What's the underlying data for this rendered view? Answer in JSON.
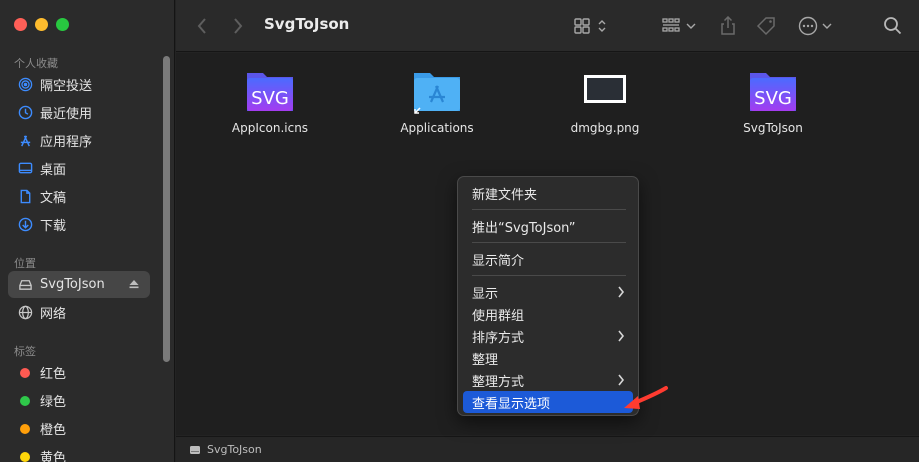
{
  "window": {
    "title": "SvgToJson"
  },
  "sidebar": {
    "favorites_header": "个人收藏",
    "favorites": [
      {
        "label": "隔空投送",
        "icon": "airdrop-icon"
      },
      {
        "label": "最近使用",
        "icon": "clock-icon"
      },
      {
        "label": "应用程序",
        "icon": "applications-icon"
      },
      {
        "label": "桌面",
        "icon": "desktop-icon"
      },
      {
        "label": "文稿",
        "icon": "document-icon"
      },
      {
        "label": "下载",
        "icon": "download-icon"
      }
    ],
    "locations_header": "位置",
    "locations": [
      {
        "label": "SvgToJson",
        "icon": "disk-icon",
        "selected": true
      },
      {
        "label": "网络",
        "icon": "network-icon"
      }
    ],
    "tags_header": "标签",
    "tags": [
      {
        "label": "红色",
        "color": "#ff5a52"
      },
      {
        "label": "绿色",
        "color": "#2fc84a"
      },
      {
        "label": "橙色",
        "color": "#ff9f0a"
      },
      {
        "label": "黄色",
        "color": "#ffd60a"
      }
    ]
  },
  "files": [
    {
      "name": "AppIcon.icns",
      "icon": "svg-badge-icon"
    },
    {
      "name": "Applications",
      "icon": "applications-folder-icon"
    },
    {
      "name": "dmgbg.png",
      "icon": "image-thumbnail-icon"
    },
    {
      "name": "SvgToJson",
      "icon": "svg-badge-icon"
    }
  ],
  "file_icon_text": "SVG",
  "context_menu": {
    "items": [
      {
        "label": "新建文件夹"
      },
      {
        "label": "推出“SvgToJson”"
      },
      {
        "label": "显示简介"
      },
      {
        "label": "显示",
        "submenu": true
      },
      {
        "label": "使用群组"
      },
      {
        "label": "排序方式",
        "submenu": true
      },
      {
        "label": "整理"
      },
      {
        "label": "整理方式",
        "submenu": true
      },
      {
        "label": "查看显示选项",
        "selected": true
      }
    ]
  },
  "pathbar": {
    "label": "SvgToJson"
  },
  "colors": {
    "accent": "#1c5ad8",
    "annotation_arrow": "#ff3b30"
  }
}
